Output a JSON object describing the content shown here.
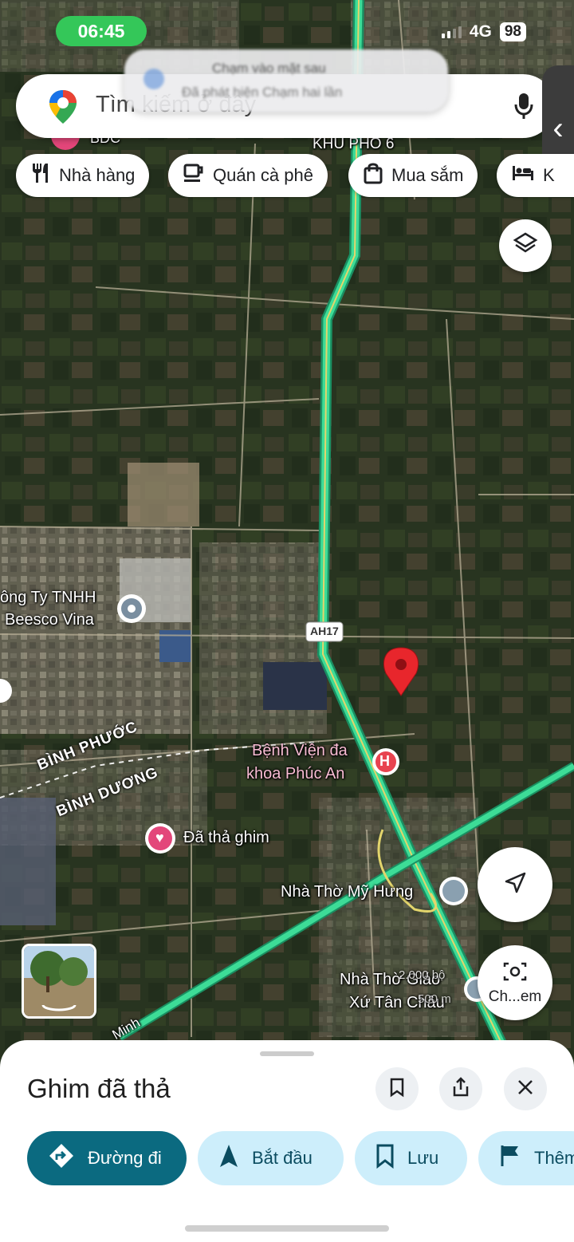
{
  "status_bar": {
    "time": "06:45",
    "network": "4G",
    "battery": "98"
  },
  "search": {
    "placeholder": "Tìm kiếm ở đây"
  },
  "toast": {
    "line1": "Chạm vào mặt sau",
    "line2": "Đã phát hiện Chạm hai lần"
  },
  "chips": [
    {
      "label": "Nhà hàng",
      "icon": "restaurant-icon"
    },
    {
      "label": "Quán cà phê",
      "icon": "coffee-icon"
    },
    {
      "label": "Mua sắm",
      "icon": "shopping-bag-icon"
    },
    {
      "label": "K",
      "icon": "hotel-icon"
    }
  ],
  "map_labels": {
    "khu_pho": "KHU PHỐ 6",
    "bdc": "BĐC",
    "company_line1": "ông Ty TNHH",
    "company_line2": "Beesco Vina",
    "road_ah17": "AH17",
    "prov_binh_phuoc": "BÌNH PHƯỚC",
    "prov_binh_duong": "BÌNH DƯƠNG",
    "hospital_line1": "Bệnh Viện đa",
    "hospital_line2": "khoa Phúc An",
    "dropped_pin": "Đã thả ghim",
    "church_my_hung": "Nhà Thờ Mỹ Hưng",
    "church_tan_chau_line1": "Nhà Thờ Giáo",
    "church_tan_chau_line2": "Xứ Tân Châu",
    "road_minh": "Minh",
    "distance": "2.000 bộ",
    "distance2": "500 m"
  },
  "buttons": {
    "camera_label": "Ch...em"
  },
  "sheet": {
    "title": "Ghim đã thả",
    "actions": [
      {
        "label": "Đường đi"
      },
      {
        "label": "Bắt đầu"
      },
      {
        "label": "Lưu"
      },
      {
        "label": "Thêm"
      }
    ]
  },
  "colors": {
    "route": "#3ddc97",
    "accent": "#0b6a80",
    "pin": "#e8262c",
    "chip_bg": "#cdeefb"
  }
}
